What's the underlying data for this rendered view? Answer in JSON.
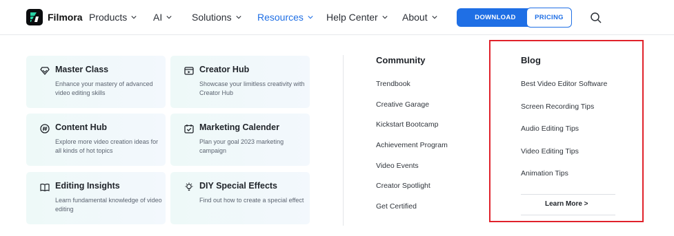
{
  "header": {
    "brand": "Filmora",
    "nav": [
      {
        "label": "Products"
      },
      {
        "label": "AI"
      },
      {
        "label": "Solutions"
      },
      {
        "label": "Resources"
      },
      {
        "label": "Help Center"
      },
      {
        "label": "About"
      }
    ],
    "download_label": "DOWNLOAD",
    "pricing_label": "PRICING",
    "accent_color": "#1f6fe5"
  },
  "cards": [
    {
      "title": "Master Class",
      "desc": "Enhance your mastery of advanced video editing skills",
      "icon": "diamond-icon"
    },
    {
      "title": "Creator Hub",
      "desc": "Showcase your limitless creativity with Creator Hub",
      "icon": "video-window-icon"
    },
    {
      "title": "Content Hub",
      "desc": "Explore more video creation ideas for all kinds of hot topics",
      "icon": "hashtag-icon"
    },
    {
      "title": "Marketing Calender",
      "desc": "Plan your goal 2023 marketing campaign",
      "icon": "calendar-check-icon"
    },
    {
      "title": "Editing Insights",
      "desc": "Learn fundamental knowledge of video editing",
      "icon": "book-icon"
    },
    {
      "title": "DIY Special Effects",
      "desc": "Find out how to create a special effect",
      "icon": "lightbulb-icon"
    }
  ],
  "community": {
    "title": "Community",
    "links": [
      "Trendbook",
      "Creative Garage",
      "Kickstart Bootcamp",
      "Achievement Program",
      "Video Events",
      "Creator Spotlight",
      "Get Certified"
    ]
  },
  "blog": {
    "title": "Blog",
    "links": [
      "Best Video Editor Software",
      "Screen Recording Tips",
      "Audio Editing Tips",
      "Video Editing Tips",
      "Animation Tips"
    ],
    "learn_more": "Learn More >",
    "highlight_color": "#e0212a"
  }
}
